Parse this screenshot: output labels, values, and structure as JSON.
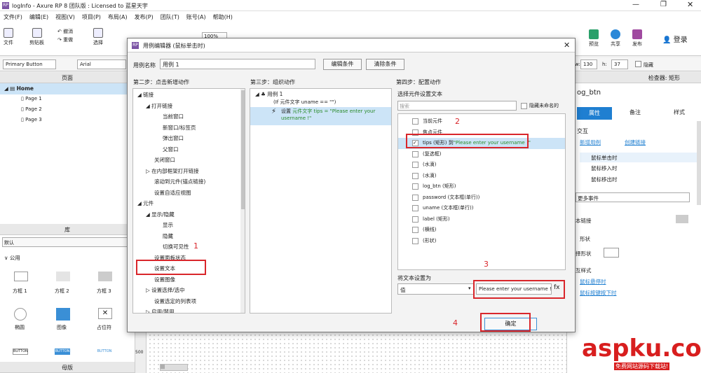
{
  "app": {
    "title": "logInfo - Axure RP 8 团队版 : Licensed to 蓝星天宇",
    "logo": "RP"
  },
  "menu": [
    "文件(F)",
    "编辑(E)",
    "视图(V)",
    "项目(P)",
    "布局(A)",
    "发布(P)",
    "团队(T)",
    "账号(A)",
    "帮助(H)"
  ],
  "toolbar": {
    "file": "文件",
    "clipboard": "剪贴板",
    "undo": "撤消",
    "redo": "重做",
    "select": "选择",
    "zoom": "100%",
    "preview": "预览",
    "share": "共享",
    "publish": "发布",
    "login": "登录"
  },
  "format": {
    "style": "Primary Button",
    "font": "Arial",
    "w_label": "w:",
    "w_value": "130",
    "h_label": "h:",
    "h_value": "37",
    "hidden": "隐藏"
  },
  "left": {
    "pages_title": "页面",
    "root": "Home",
    "pages": [
      "Page 1",
      "Page 2",
      "Page 3"
    ],
    "library_title": "库",
    "library_select": "默认",
    "group": "公用",
    "widgets": [
      "方框 1",
      "方框 2",
      "方框 3",
      "椭圆",
      "图像",
      "占位符"
    ],
    "buttons": [
      "BUTTON",
      "BUTTON",
      "BUTTON"
    ],
    "masters_title": "母版"
  },
  "right": {
    "title": "检查器: 矩形",
    "name": "og_btn",
    "tabs": [
      "属性",
      "备注",
      "样式"
    ],
    "interaction": "交互",
    "new_case": "新增用例",
    "create_link": "创建链接",
    "events": [
      "鼠标单击时",
      "鼠标移入时",
      "鼠标移出时"
    ],
    "more": "更多事件",
    "text_link": "本链接",
    "shape": "形状",
    "select_shape": "择形状",
    "hover_style": "互样式",
    "hover": "鼠标悬停时",
    "mousedown": "鼠标按键按下时"
  },
  "dialog": {
    "title": "用例编辑器 (鼠标单击时)",
    "case_label": "用例名称",
    "case_name": "用例 1",
    "edit_condition": "编辑条件",
    "clear_condition": "清除条件",
    "step2": "第二步：点击新增动作",
    "step3": "第三步：组织动作",
    "step4": "第四步：配置动作",
    "actions": [
      {
        "t": "◢  链接",
        "i": 0
      },
      {
        "t": "◢  打开链接",
        "i": 1
      },
      {
        "t": "当前窗口",
        "i": 3
      },
      {
        "t": "新窗口/标签页",
        "i": 3
      },
      {
        "t": "弹出窗口",
        "i": 3
      },
      {
        "t": "父窗口",
        "i": 3
      },
      {
        "t": "关闭窗口",
        "i": 2
      },
      {
        "t": "▷  在内部框架打开链接",
        "i": 1
      },
      {
        "t": "滚动到元件(锚点链接)",
        "i": 2
      },
      {
        "t": "设置自适应视图",
        "i": 2
      },
      {
        "t": "◢  元件",
        "i": 0
      },
      {
        "t": "◢  显示/隐藏",
        "i": 1
      },
      {
        "t": "显示",
        "i": 3
      },
      {
        "t": "隐藏",
        "i": 3
      },
      {
        "t": "切换可见性",
        "i": 3
      },
      {
        "t": "设置面板状态",
        "i": 2
      },
      {
        "t": "设置文本",
        "i": 2
      },
      {
        "t": "设置图像",
        "i": 2
      },
      {
        "t": "▷  设置选择/选中",
        "i": 1
      },
      {
        "t": "设置选定的列表项",
        "i": 2
      },
      {
        "t": "▷  启用/禁用",
        "i": 1
      }
    ],
    "organize": {
      "case": "用例 1",
      "condition": "(If 元件文字 uname == \"\")",
      "action_prefix": "设置 ",
      "action_detail": "元件文字 tips = \"Please enter your username !\""
    },
    "config_title": "选择元件设置文本",
    "search_placeholder": "搜索",
    "hide_unnamed": "隐藏未命名的",
    "widgets": [
      {
        "label": "当前元件",
        "checked": false
      },
      {
        "label": "焦点元件",
        "checked": false
      },
      {
        "label": "tips (矩形) 到",
        "value": "\"Please enter your username !\"",
        "checked": true
      },
      {
        "label": "(复选框)",
        "checked": false
      },
      {
        "label": "(水滴)",
        "checked": false
      },
      {
        "label": "(水滴)",
        "checked": false
      },
      {
        "label": "log_btn (矩形)",
        "checked": false
      },
      {
        "label": "password (文本框(单行))",
        "checked": false
      },
      {
        "label": "uname (文本框(单行))",
        "checked": false
      },
      {
        "label": "label (矩形)",
        "checked": false
      },
      {
        "label": "(横线)",
        "checked": false
      },
      {
        "label": "(形状)",
        "checked": false
      }
    ],
    "set_text_label": "将文本设置为",
    "set_type": "值",
    "set_value": "Please enter your username !",
    "fx": "fx",
    "ok": "确定",
    "markers": [
      "1",
      "2",
      "3",
      "4"
    ]
  },
  "colors": {
    "accent": "#1f7fd1",
    "annotation": "#d9262b",
    "highlight": "#cce4f7",
    "brand": "#7a52a4",
    "watermark": "#d81e1e"
  },
  "watermark": {
    "text": "aspku.com",
    "sub": "免费网站源码下载站!"
  },
  "ruler": {
    "value": "500"
  }
}
